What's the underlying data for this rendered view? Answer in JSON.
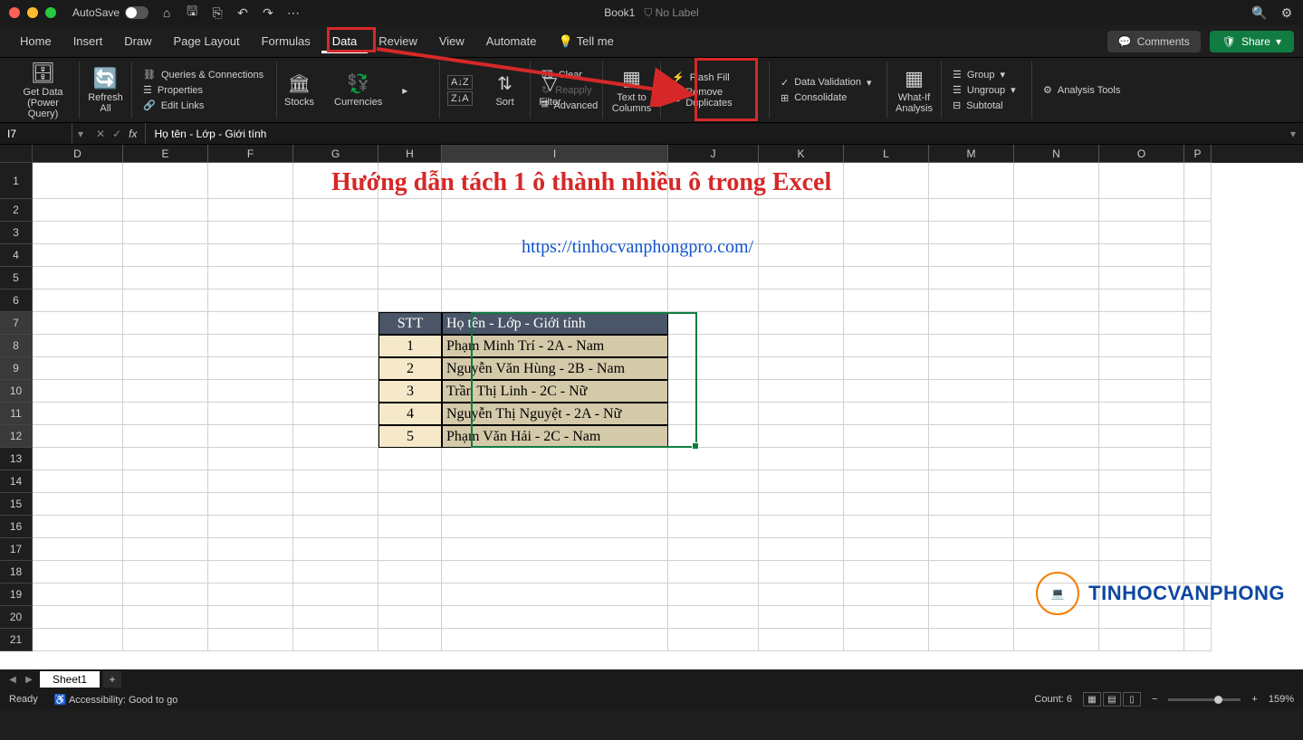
{
  "titlebar": {
    "autosave": "AutoSave",
    "book": "Book1",
    "label": "No Label"
  },
  "tabs": [
    "Home",
    "Insert",
    "Draw",
    "Page Layout",
    "Formulas",
    "Data",
    "Review",
    "View",
    "Automate",
    "Tell me"
  ],
  "active_tab": "Data",
  "comments": "Comments",
  "share": "Share",
  "ribbon": {
    "get_data": "Get Data (Power Query)",
    "refresh": "Refresh All",
    "queries": "Queries & Connections",
    "properties": "Properties",
    "edit_links": "Edit Links",
    "stocks": "Stocks",
    "currencies": "Currencies",
    "sort": "Sort",
    "filter": "Filter",
    "clear": "Clear",
    "reapply": "Reapply",
    "advanced": "Advanced",
    "text_to_columns": "Text to Columns",
    "flash_fill": "Flash Fill",
    "remove_dup": "Remove Duplicates",
    "data_val": "Data Validation",
    "consolidate": "Consolidate",
    "what_if": "What-If Analysis",
    "group": "Group",
    "ungroup": "Ungroup",
    "subtotal": "Subtotal",
    "analysis": "Analysis Tools"
  },
  "name_box": "I7",
  "formula": "Họ tên - Lớp - Giới tính",
  "columns": [
    "D",
    "E",
    "F",
    "G",
    "H",
    "I",
    "J",
    "K",
    "L",
    "M",
    "N",
    "O",
    "P"
  ],
  "rows": [
    1,
    2,
    3,
    4,
    5,
    6,
    7,
    8,
    9,
    10,
    11,
    12,
    13,
    14,
    15,
    16,
    17,
    18,
    19,
    20,
    21
  ],
  "content": {
    "title": "Hướng dẫn tách 1 ô thành nhiều ô trong Excel",
    "url": "https://tinhocvanphongpro.com/",
    "header_stt": "STT",
    "header_name": "Họ tên - Lớp - Giới tính",
    "table": [
      {
        "stt": "1",
        "name": "Phạm Minh Trí - 2A - Nam"
      },
      {
        "stt": "2",
        "name": "Nguyễn Văn Hùng - 2B - Nam"
      },
      {
        "stt": "3",
        "name": "Trần Thị Linh - 2C - Nữ"
      },
      {
        "stt": "4",
        "name": "Nguyễn Thị Nguyệt - 2A - Nữ"
      },
      {
        "stt": "5",
        "name": "Phạm Văn Hải - 2C - Nam"
      }
    ]
  },
  "watermark": "TINHOCVANPHONG",
  "sheet": "Sheet1",
  "status": {
    "ready": "Ready",
    "accessibility": "Accessibility: Good to go",
    "count": "Count: 6",
    "zoom": "159%"
  }
}
